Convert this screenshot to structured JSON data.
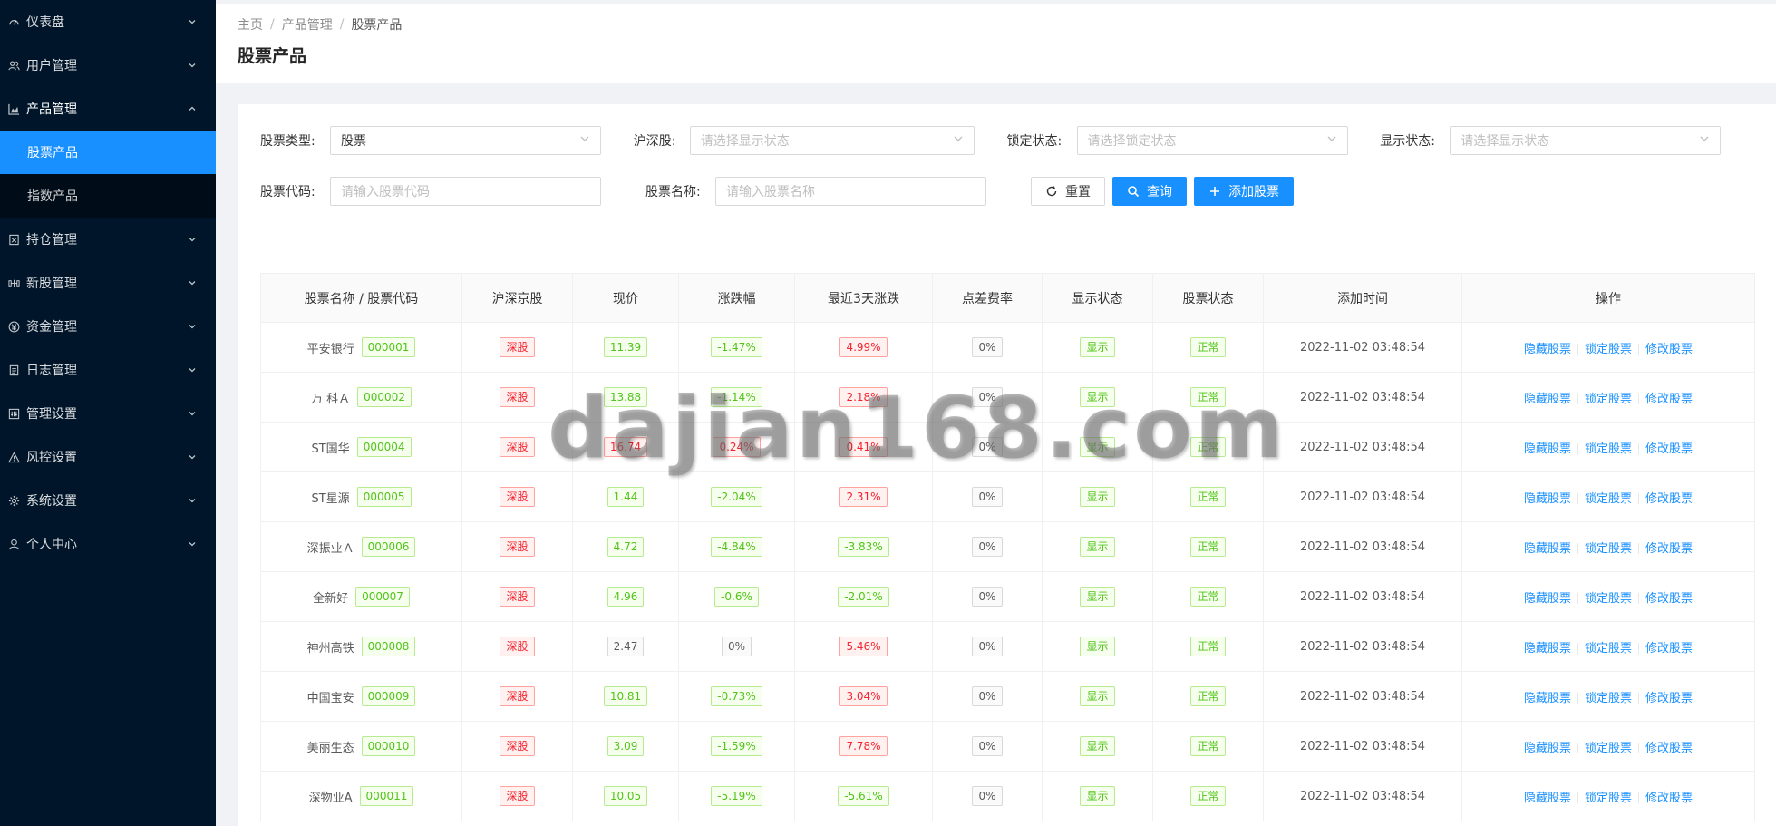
{
  "sidebar": {
    "items": [
      {
        "label": "仪表盘",
        "icon": "dashboard-icon",
        "open": false
      },
      {
        "label": "用户管理",
        "icon": "user-group-icon",
        "open": false
      },
      {
        "label": "产品管理",
        "icon": "area-chart-icon",
        "open": true,
        "children": [
          {
            "label": "股票产品",
            "active": true
          },
          {
            "label": "指数产品",
            "active": false
          }
        ]
      },
      {
        "label": "持仓管理",
        "icon": "holding-icon",
        "open": false
      },
      {
        "label": "新股管理",
        "icon": "new-stock-icon",
        "open": false
      },
      {
        "label": "资金管理",
        "icon": "money-icon",
        "open": false
      },
      {
        "label": "日志管理",
        "icon": "log-icon",
        "open": false
      },
      {
        "label": "管理设置",
        "icon": "admin-settings-icon",
        "open": false
      },
      {
        "label": "风控设置",
        "icon": "warning-icon",
        "open": false
      },
      {
        "label": "系统设置",
        "icon": "gear-icon",
        "open": false
      },
      {
        "label": "个人中心",
        "icon": "person-icon",
        "open": false
      }
    ]
  },
  "breadcrumb": [
    "主页",
    "产品管理",
    "股票产品"
  ],
  "page_title": "股票产品",
  "filters": {
    "stock_type": {
      "label": "股票类型:",
      "value": "股票"
    },
    "market": {
      "label": "沪深股:",
      "placeholder": "请选择显示状态"
    },
    "lock_status": {
      "label": "锁定状态:",
      "placeholder": "请选择锁定状态"
    },
    "show_status": {
      "label": "显示状态:",
      "placeholder": "请选择显示状态"
    },
    "code": {
      "label": "股票代码:",
      "placeholder": "请输入股票代码"
    },
    "name": {
      "label": "股票名称:",
      "placeholder": "请输入股票名称"
    }
  },
  "buttons": {
    "reset": "重置",
    "query": "查询",
    "add": "添加股票"
  },
  "table": {
    "columns": [
      "股票名称 / 股票代码",
      "沪深京股",
      "现价",
      "涨跌幅",
      "最近3天涨跌",
      "点差费率",
      "显示状态",
      "股票状态",
      "添加时间",
      "操作"
    ],
    "actions": [
      "隐藏股票",
      "锁定股票",
      "修改股票"
    ],
    "rows": [
      {
        "name": "平安银行",
        "code": "000001",
        "market": "深股",
        "price": "11.39",
        "change": "-1.47%",
        "change3": "4.99%",
        "spread": "0%",
        "show": "显示",
        "status": "正常",
        "time": "2022-11-02 03:48:54",
        "priceColor": "green",
        "changeColor": "green",
        "change3Color": "red"
      },
      {
        "name": "万 科Ａ",
        "code": "000002",
        "market": "深股",
        "price": "13.88",
        "change": "-1.14%",
        "change3": "2.18%",
        "spread": "0%",
        "show": "显示",
        "status": "正常",
        "time": "2022-11-02 03:48:54",
        "priceColor": "green",
        "changeColor": "green",
        "change3Color": "red"
      },
      {
        "name": "ST国华",
        "code": "000004",
        "market": "深股",
        "price": "16.74",
        "change": "0.24%",
        "change3": "0.41%",
        "spread": "0%",
        "show": "显示",
        "status": "正常",
        "time": "2022-11-02 03:48:54",
        "priceColor": "red",
        "changeColor": "red",
        "change3Color": "red"
      },
      {
        "name": "ST星源",
        "code": "000005",
        "market": "深股",
        "price": "1.44",
        "change": "-2.04%",
        "change3": "2.31%",
        "spread": "0%",
        "show": "显示",
        "status": "正常",
        "time": "2022-11-02 03:48:54",
        "priceColor": "green",
        "changeColor": "green",
        "change3Color": "red"
      },
      {
        "name": "深振业Ａ",
        "code": "000006",
        "market": "深股",
        "price": "4.72",
        "change": "-4.84%",
        "change3": "-3.83%",
        "spread": "0%",
        "show": "显示",
        "status": "正常",
        "time": "2022-11-02 03:48:54",
        "priceColor": "green",
        "changeColor": "green",
        "change3Color": "green"
      },
      {
        "name": "全新好",
        "code": "000007",
        "market": "深股",
        "price": "4.96",
        "change": "-0.6%",
        "change3": "-2.01%",
        "spread": "0%",
        "show": "显示",
        "status": "正常",
        "time": "2022-11-02 03:48:54",
        "priceColor": "green",
        "changeColor": "green",
        "change3Color": "green"
      },
      {
        "name": "神州高铁",
        "code": "000008",
        "market": "深股",
        "price": "2.47",
        "change": "0%",
        "change3": "5.46%",
        "spread": "0%",
        "show": "显示",
        "status": "正常",
        "time": "2022-11-02 03:48:54",
        "priceColor": "gray",
        "changeColor": "gray",
        "change3Color": "red"
      },
      {
        "name": "中国宝安",
        "code": "000009",
        "market": "深股",
        "price": "10.81",
        "change": "-0.73%",
        "change3": "3.04%",
        "spread": "0%",
        "show": "显示",
        "status": "正常",
        "time": "2022-11-02 03:48:54",
        "priceColor": "green",
        "changeColor": "green",
        "change3Color": "red"
      },
      {
        "name": "美丽生态",
        "code": "000010",
        "market": "深股",
        "price": "3.09",
        "change": "-1.59%",
        "change3": "7.78%",
        "spread": "0%",
        "show": "显示",
        "status": "正常",
        "time": "2022-11-02 03:48:54",
        "priceColor": "green",
        "changeColor": "green",
        "change3Color": "red"
      },
      {
        "name": "深物业A",
        "code": "000011",
        "market": "深股",
        "price": "10.05",
        "change": "-5.19%",
        "change3": "-5.61%",
        "spread": "0%",
        "show": "显示",
        "status": "正常",
        "time": "2022-11-02 03:48:54",
        "priceColor": "green",
        "changeColor": "green",
        "change3Color": "green"
      }
    ]
  },
  "watermark": "dajian168.com",
  "colors": {
    "sidebar_bg": "#001529",
    "primary": "#1890ff",
    "up": "#f5222d",
    "down": "#52c41a"
  }
}
